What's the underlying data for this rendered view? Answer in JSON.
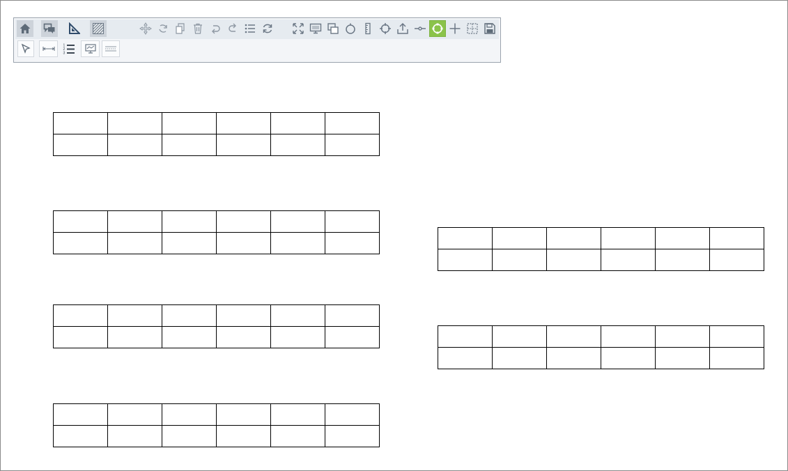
{
  "toolbar": {
    "row1": [
      {
        "name": "home-icon",
        "icon": "home"
      },
      {
        "name": "chat-icon",
        "icon": "chat"
      },
      {
        "name": "set-square-icon",
        "icon": "setsquare"
      },
      {
        "name": "hatch-pattern-icon",
        "icon": "hatch"
      },
      {
        "name": "move-icon",
        "icon": "move"
      },
      {
        "name": "rotate-icon",
        "icon": "rotate"
      },
      {
        "name": "copy-icon",
        "icon": "copy"
      },
      {
        "name": "trash-icon",
        "icon": "trash"
      },
      {
        "name": "undo-icon",
        "icon": "undo"
      },
      {
        "name": "redo-icon",
        "icon": "redo"
      },
      {
        "name": "list-icon",
        "icon": "list"
      },
      {
        "name": "refresh-icon",
        "icon": "refresh"
      },
      {
        "name": "fit-to-screen-icon",
        "icon": "fit"
      },
      {
        "name": "monitor-icon",
        "icon": "monitor"
      },
      {
        "name": "layers-icon",
        "icon": "layers"
      },
      {
        "name": "circle-icon",
        "icon": "circle"
      },
      {
        "name": "ruler-icon",
        "icon": "ruler"
      },
      {
        "name": "crosshair-icon",
        "icon": "crosshair"
      },
      {
        "name": "upload-icon",
        "icon": "upload"
      },
      {
        "name": "connector-icon",
        "icon": "connector"
      },
      {
        "name": "node-circle-icon",
        "icon": "nodecircle"
      },
      {
        "name": "plus-icon",
        "icon": "plus"
      },
      {
        "name": "grid-icon",
        "icon": "grid"
      },
      {
        "name": "save-icon",
        "icon": "save"
      }
    ],
    "row2": [
      {
        "name": "pointer-icon",
        "icon": "pointer"
      },
      {
        "name": "dimension-icon",
        "icon": "dimension"
      },
      {
        "name": "numbered-list-icon",
        "icon": "numlist"
      },
      {
        "name": "display-icon",
        "icon": "display"
      },
      {
        "name": "dashed-lines-icon",
        "icon": "dashed"
      }
    ],
    "active_tool": "node-circle-icon",
    "accent_color": "#8bc34a"
  },
  "tables": [
    {
      "name": "grid-table-1",
      "rows": 2,
      "cols": 6
    },
    {
      "name": "grid-table-2",
      "rows": 2,
      "cols": 6
    },
    {
      "name": "grid-table-3",
      "rows": 2,
      "cols": 6
    },
    {
      "name": "grid-table-4",
      "rows": 2,
      "cols": 6
    },
    {
      "name": "grid-table-5",
      "rows": 2,
      "cols": 6
    },
    {
      "name": "grid-table-6",
      "rows": 2,
      "cols": 6
    }
  ]
}
